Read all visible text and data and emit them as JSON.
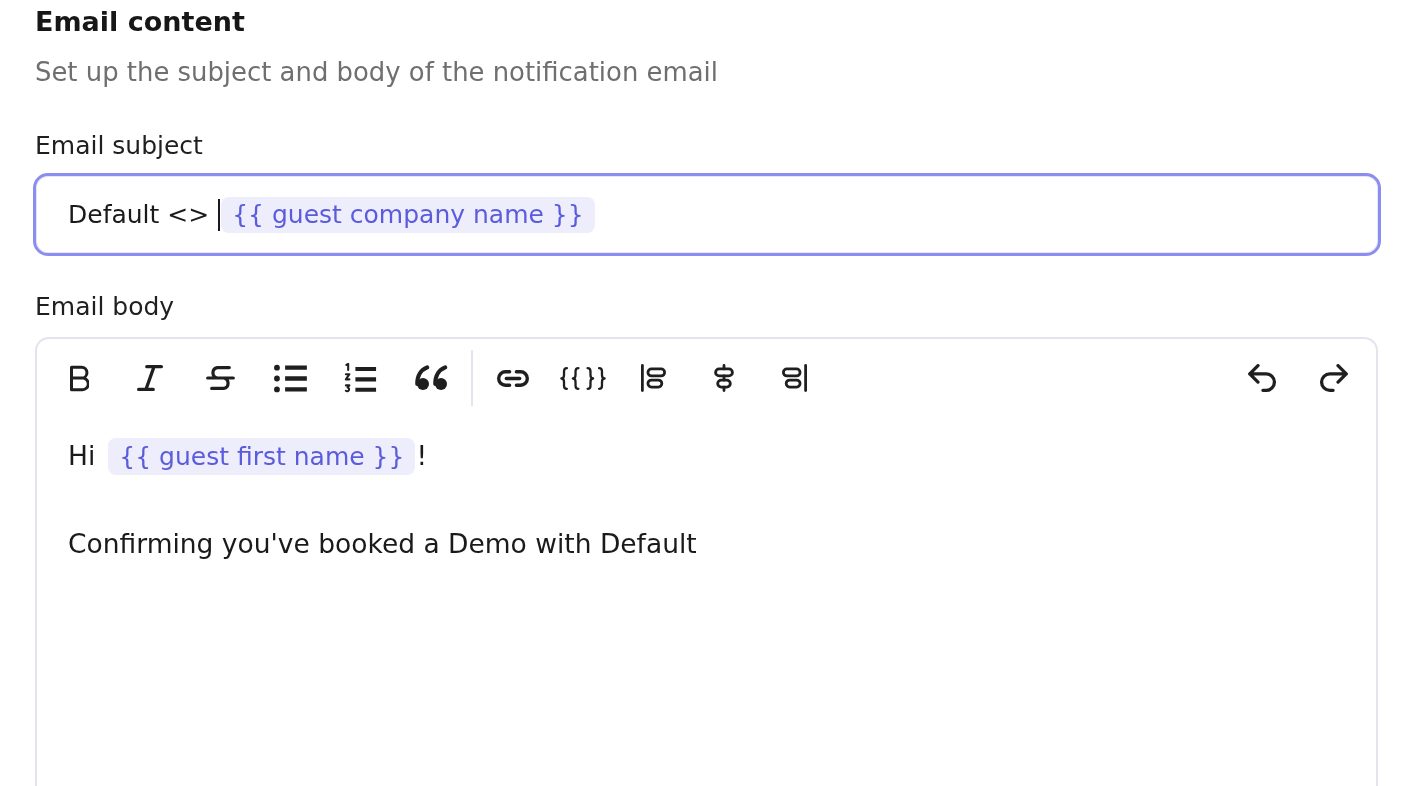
{
  "section": {
    "title": "Email content",
    "description": "Set up the subject and body of the notification email"
  },
  "subject": {
    "label": "Email subject",
    "focused": true,
    "content": [
      {
        "kind": "text",
        "text": "Default <>"
      },
      {
        "kind": "caret"
      },
      {
        "kind": "variable",
        "text": "{{ guest company name }}"
      }
    ]
  },
  "body": {
    "label": "Email body",
    "paragraphs": [
      {
        "content": [
          {
            "kind": "text",
            "text": "Hi"
          },
          {
            "kind": "variable",
            "text": "{{ guest first name }}"
          },
          {
            "kind": "text",
            "text": "!"
          }
        ]
      },
      {
        "content": [
          {
            "kind": "text",
            "text": "Confirming you've booked a Demo with Default"
          }
        ]
      }
    ]
  }
}
